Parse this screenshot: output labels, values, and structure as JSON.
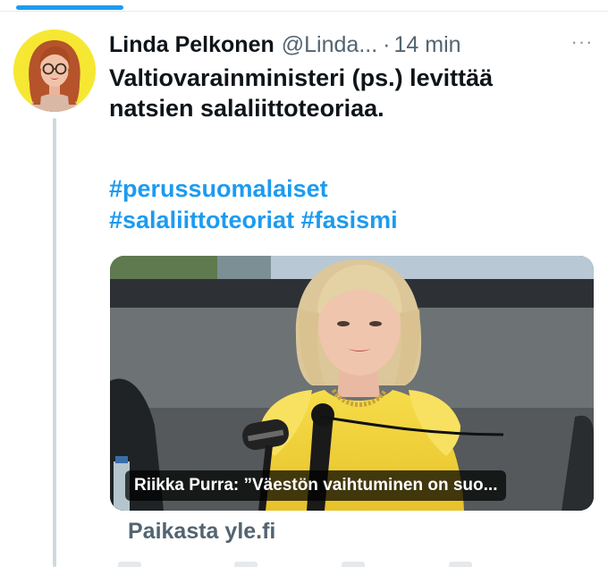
{
  "tweet": {
    "display_name": "Linda Pelkonen",
    "handle": "@Linda...",
    "separator": "·",
    "time_ago": "14 min",
    "more_label": "···",
    "text_line1": "Valtiovarainministeri (ps.) levittää",
    "text_line2": "natsien salaliittoteoriaa.",
    "hashtags": [
      "#perussuomalaiset",
      "#salaliittoteoriat",
      "#fasismi"
    ]
  },
  "card": {
    "caption": "Riikka Purra: ”Väestön vaihtuminen on suo...",
    "source": "Paikasta yle.fi"
  },
  "colors": {
    "accent": "#1d9bf0",
    "text_primary": "#0f1419",
    "text_secondary": "#536471",
    "avatar_bg": "#f6e832",
    "thread_line": "#cfd9de",
    "card_dress": "#f2d23a"
  },
  "icons": {
    "more": "more-horizontal-icon"
  }
}
